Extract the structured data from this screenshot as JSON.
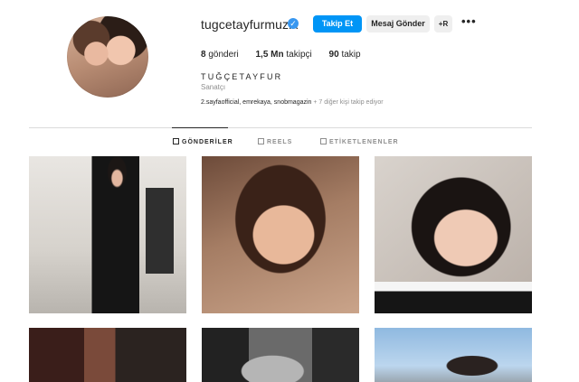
{
  "profile": {
    "username": "tugcetayfurmuzik",
    "verified_glyph": "✓",
    "follow_label": "Takip Et",
    "message_label": "Mesaj Gönder",
    "suggest_label": "+R",
    "more_label": "•••",
    "stats": {
      "posts_count": "8",
      "posts_label": "gönderi",
      "followers_count": "1,5 Mn",
      "followers_label": "takipçi",
      "following_count": "90",
      "following_label": "takip"
    },
    "full_name": "TUĞÇETAYFUR",
    "category": "Sanatçı",
    "followed_by_names": "2.sayfaofficial, emrekaya, snobmagazin",
    "followed_by_suffix": " + 7 diğer kişi takip ediyor"
  },
  "tabs": [
    {
      "label": "GÖNDERİLER",
      "active": true,
      "icon": "grid-icon"
    },
    {
      "label": "REELS",
      "active": false,
      "icon": "reels-icon"
    },
    {
      "label": "ETİKETLENENLER",
      "active": false,
      "icon": "tagged-icon"
    }
  ],
  "colors": {
    "accent": "#0095f6",
    "verified": "#3897f0",
    "secondary_text": "#8e8e8e",
    "divider": "#dbdbdb"
  }
}
